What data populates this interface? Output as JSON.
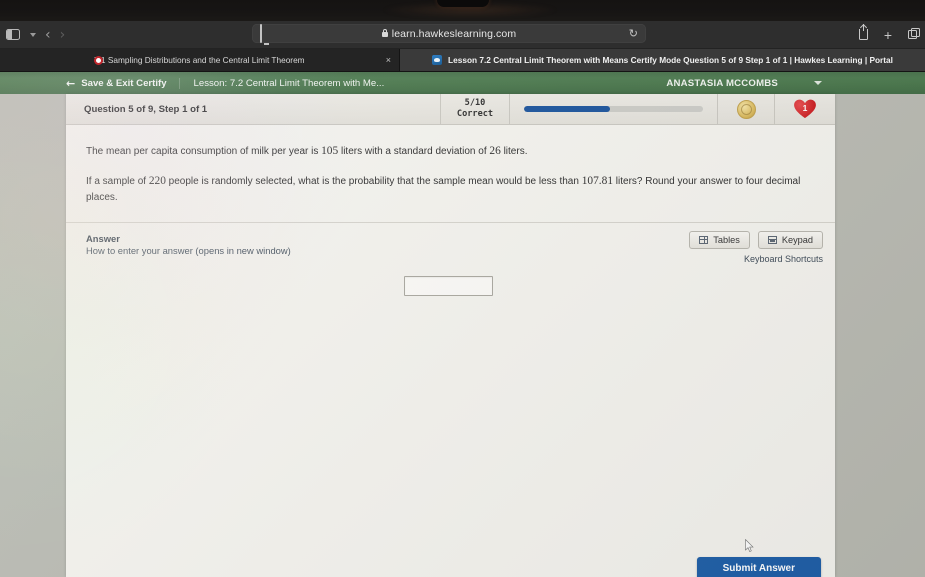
{
  "browser": {
    "toolbar": {
      "sidebar_icon": "sidebar-icon",
      "dropdown_icon": "chevron-down-icon",
      "back_label": "‹",
      "forward_label": "›",
      "url": "learn.hawkeslearning.com",
      "reload_label": "↻",
      "share_icon": "share-icon",
      "new_tab_label": "+",
      "tab_overview_icon": "tab-overview-icon"
    },
    "tabs": [
      {
        "title": "7.1 Sampling Distributions and the Central Limit Theorem",
        "active": false,
        "close_label": "×"
      },
      {
        "title": "Lesson 7.2 Central Limit Theorem with Means Certify Mode Question 5 of 9 Step 1 of 1 | Hawkes Learning | Portal",
        "active": true,
        "close_label": ""
      }
    ]
  },
  "app": {
    "header": {
      "save_exit_label": "Save & Exit Certify",
      "back_arrow": "←",
      "lesson_title": "Lesson: 7.2 Central Limit Theorem with Me...",
      "user_name": "ANASTASIA MCCOMBS"
    },
    "question_bar": {
      "question_label": "Question 5 of 9, Step 1 of 1",
      "score_value": "5/10",
      "score_label": "Correct",
      "progress_percent": 48,
      "progress_color": "#17519b",
      "coin_icon": "coin-icon",
      "lives_icon": "heart-icon",
      "lives_count": "1",
      "lives_color": "#c8171b"
    },
    "question": {
      "paragraph1_pre": "The mean per capita consumption of milk per year is ",
      "mean_value": "105",
      "paragraph1_mid": " liters with a standard deviation of ",
      "sd_value": "26",
      "paragraph1_post": " liters.",
      "paragraph2_pre": "If a sample of ",
      "sample_size": "220",
      "paragraph2_mid": " people is randomly selected, what is the probability that the sample mean would be less than ",
      "threshold": "107.81",
      "paragraph2_post": " liters? Round your answer to four decimal places."
    },
    "answer": {
      "title": "Answer",
      "help_link": "How to enter your answer (opens in new window)",
      "tables_button": "Tables",
      "keypad_button": "Keypad",
      "keyboard_shortcuts": "Keyboard Shortcuts",
      "input_value": "",
      "input_placeholder": ""
    },
    "footer": {
      "submit_label": "Submit Answer",
      "submit_color": "#1f5fa8"
    }
  }
}
